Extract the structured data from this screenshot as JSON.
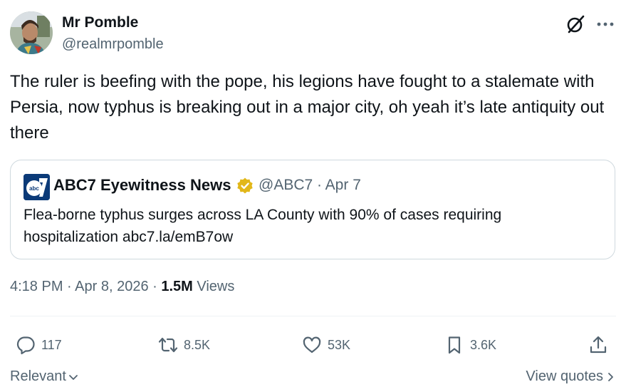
{
  "author": {
    "name": "Mr Pomble",
    "handle": "@realmrpomble"
  },
  "tweet": {
    "text": "The ruler is beefing with the pope, his legions have fought to a stalemate with Persia, now typhus is breaking out in a major city, oh yeah it’s late antiquity out there"
  },
  "quote": {
    "logo_text": "abc",
    "name": "ABC7 Eyewitness News",
    "handle_date": "@ABC7 · Apr 7",
    "text": "Flea-borne typhus surges across LA County with 90% of cases requiring hospitalization abc7.la/emB7ow"
  },
  "meta": {
    "timestamp": "4:18 PM · Apr 8, 2026 · ",
    "views_count": "1.5M",
    "views_label": " Views"
  },
  "actions": {
    "replies": "117",
    "reposts": "8.5K",
    "likes": "53K",
    "bookmarks": "3.6K"
  },
  "footer": {
    "sort_label": "Relevant",
    "view_quotes_label": "View quotes"
  },
  "icons": {
    "grok": "grok-icon",
    "more": "more-icon",
    "verified": "verified-badge-icon",
    "reply": "reply-icon",
    "retweet": "retweet-icon",
    "like": "heart-icon",
    "bookmark": "bookmark-icon",
    "share": "share-icon"
  },
  "colors": {
    "text_primary": "#0f1419",
    "text_secondary": "#536471",
    "border": "#cfd9de",
    "verified_gold": "#e2b719"
  }
}
